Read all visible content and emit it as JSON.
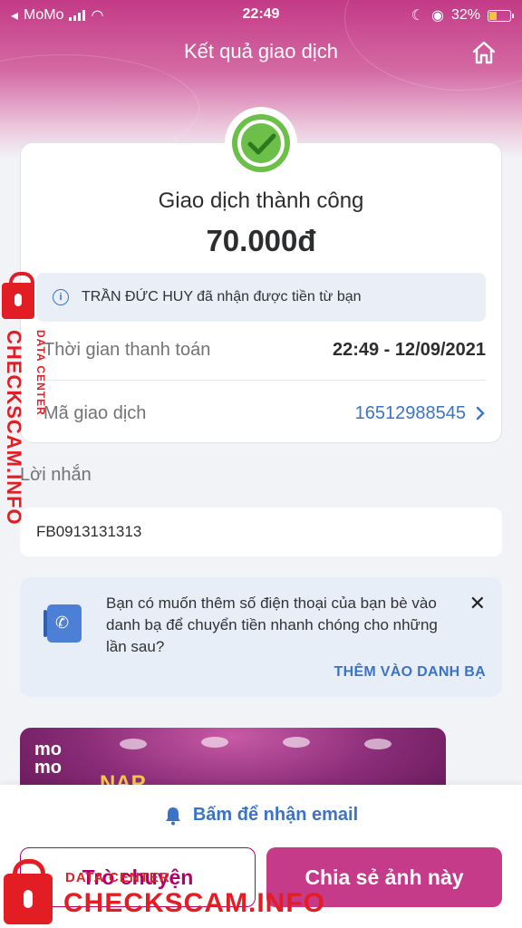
{
  "status_bar": {
    "carrier": "MoMo",
    "time": "22:49",
    "battery": "32%"
  },
  "header": {
    "title": "Kết quả giao dịch"
  },
  "result": {
    "status": "Giao dịch thành công",
    "amount": "70.000đ",
    "recipient_note": "TRẦN ĐỨC HUY đã nhận được tiền từ bạn",
    "time_label": "Thời gian thanh toán",
    "time_value": "22:49 - 12/09/2021",
    "txn_label": "Mã giao dịch",
    "txn_value": "16512988545"
  },
  "message": {
    "label": "Lời nhắn",
    "value": "FB0913131313"
  },
  "contact_prompt": {
    "text": "Bạn có muốn thêm số điện thoại của bạn bè vào danh bạ để chuyển tiền nhanh chóng cho những lần sau?",
    "action": "THÊM VÀO DANH BẠ"
  },
  "promo": {
    "logo_line1": "mo",
    "logo_line2": "mo",
    "headline": "NAP"
  },
  "footer": {
    "email_label": "Bấm để nhận email",
    "chat_label": "Trò chuyện",
    "share_label": "Chia sẻ ảnh này"
  },
  "watermark": {
    "small": "DATA CENTER",
    "big": "CHECKSCAM.INFO"
  },
  "colors": {
    "brand": "#c63a8a",
    "success": "#6cc04a",
    "link": "#3b73c7",
    "watermark": "#e21d23"
  }
}
